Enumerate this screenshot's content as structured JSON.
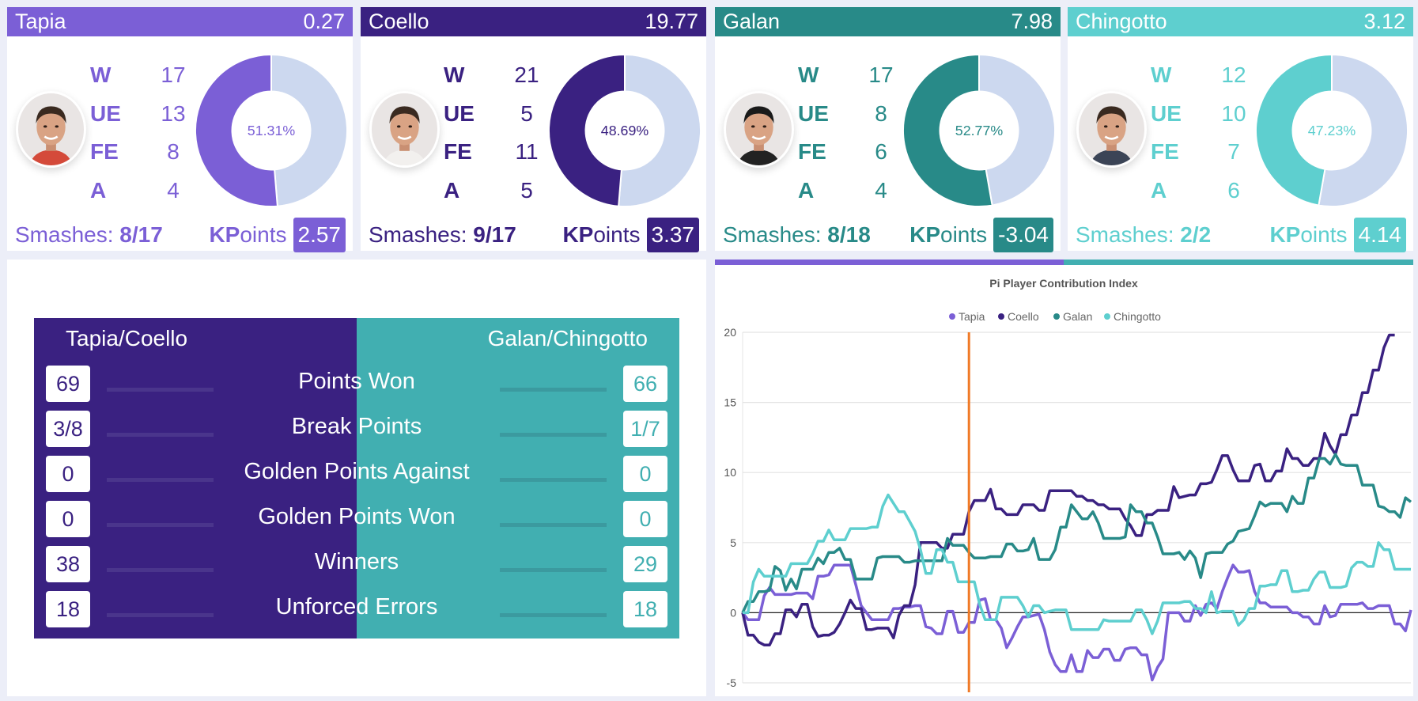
{
  "players": [
    {
      "name": "Tapia",
      "score": "0.27",
      "color": "#7b5fd6",
      "W": "17",
      "UE": "13",
      "FE": "8",
      "A": "4",
      "pct": 51.31,
      "pct_label": "51.31%",
      "smashes_label": "Smashes:",
      "smashes": "8/17",
      "kp_k": "KP",
      "kp_rest": "oints",
      "kpoints": "2.57",
      "avatar": "player-photo"
    },
    {
      "name": "Coello",
      "score": "19.77",
      "color": "#3a2181",
      "W": "21",
      "UE": "5",
      "FE": "11",
      "A": "5",
      "pct": 48.69,
      "pct_label": "48.69%",
      "smashes_label": "Smashes:",
      "smashes": "9/17",
      "kp_k": "KP",
      "kp_rest": "oints",
      "kpoints": "3.37",
      "avatar": "player-photo"
    },
    {
      "name": "Galan",
      "score": "7.98",
      "color": "#288a88",
      "W": "17",
      "UE": "8",
      "FE": "6",
      "A": "4",
      "pct": 52.77,
      "pct_label": "52.77%",
      "smashes_label": "Smashes:",
      "smashes": "8/18",
      "kp_k": "KP",
      "kp_rest": "oints",
      "kpoints": "-3.04",
      "avatar": "player-photo"
    },
    {
      "name": "Chingotto",
      "score": "3.12",
      "color": "#5ecfcf",
      "W": "12",
      "UE": "10",
      "FE": "7",
      "A": "6",
      "pct": 47.23,
      "pct_label": "47.23%",
      "smashes_label": "Smashes:",
      "smashes": "2/2",
      "kp_k": "KP",
      "kp_rest": "oints",
      "kpoints": "4.14",
      "avatar": "player-photo"
    }
  ],
  "stat_labels": {
    "W": "W",
    "UE": "UE",
    "FE": "FE",
    "A": "A"
  },
  "donut_remainder_color": "#ccd8ef",
  "comparison": {
    "left_team": "Tapia/Coello",
    "right_team": "Galan/Chingotto",
    "left_color": "#3a2181",
    "right_color": "#41afb1",
    "rows": [
      {
        "label": "Points Won",
        "left": "69",
        "right": "66"
      },
      {
        "label": "Break Points",
        "left": "3/8",
        "right": "1/7"
      },
      {
        "label": "Golden Points Against",
        "left": "0",
        "right": "0"
      },
      {
        "label": "Golden Points Won",
        "left": "0",
        "right": "0"
      },
      {
        "label": "Winners",
        "left": "38",
        "right": "29"
      },
      {
        "label": "Unforced Errors",
        "left": "18",
        "right": "18"
      }
    ]
  },
  "chart_data": {
    "type": "line",
    "title": "Pi Player Contribution Index",
    "xlabel": "",
    "ylabel": "",
    "ylim": [
      -5,
      20
    ],
    "yticks": [
      "20",
      "15",
      "10",
      "5",
      "0",
      "-5"
    ],
    "grid": true,
    "legend": "top-center",
    "marker_index": 42,
    "marker_color": "#f07a26",
    "series": [
      {
        "name": "Tapia",
        "color": "#7b5fd6",
        "values": [
          0,
          -0.5,
          -0.5,
          -0.5,
          1.2,
          1.8,
          1.3,
          1.3,
          1.3,
          1.3,
          1.4,
          1.4,
          1.4,
          1,
          2.6,
          2.6,
          2.7,
          3.4,
          3.4,
          3.4,
          3.4,
          2,
          0.5,
          0,
          -0.5,
          -0.5,
          -0.5,
          -0.5,
          0.3,
          0.3,
          0.4,
          0.4,
          0.5,
          0.5,
          -1,
          -1.1,
          -1.5,
          -1.5,
          0.1,
          0.1,
          -1.4,
          -1.4,
          -0.7,
          -0.7,
          0.9,
          1,
          -0.5,
          -0.5,
          -1.1,
          -2.5,
          -1.8,
          -1,
          -0.3,
          -0.3,
          -0.2,
          -0.1,
          -1.2,
          -2.8,
          -3.7,
          -4.2,
          -4.2,
          -3,
          -4.2,
          -4.2,
          -2.7,
          -3.2,
          -3.2,
          -2.6,
          -2.6,
          -3.4,
          -3.4,
          -2.6,
          -2.5,
          -2.5,
          -3,
          -3,
          -4.8,
          -3.9,
          -3.3,
          0,
          0,
          0,
          -0.6,
          -0.6,
          0.5,
          -0.2,
          0.6,
          0.7,
          0.3,
          1.5,
          2.5,
          3.4,
          2.9,
          2.9,
          3,
          1.5,
          0.7,
          0.7,
          0.4,
          0.4,
          0.4,
          0.4,
          0,
          0,
          -0.3,
          -0.3,
          -0.8,
          -0.8,
          0.5,
          -0.3,
          -0.2,
          0.6,
          0.6,
          0.6,
          0.6,
          0.7,
          0.3,
          0.3,
          0.5,
          0.5,
          0.5,
          -0.8,
          -0.8,
          -1.3,
          0.2
        ]
      },
      {
        "name": "Coello",
        "color": "#3a2181",
        "values": [
          0,
          -1.6,
          -1.6,
          -2.1,
          -2.3,
          -2.3,
          -1.5,
          -1.5,
          0.2,
          0.2,
          -0.3,
          0.6,
          0.6,
          -1,
          -1.7,
          -1.6,
          -1.6,
          -1.4,
          -0.8,
          0,
          0.9,
          0.3,
          0.3,
          -1.2,
          -1.2,
          -1.1,
          -1.1,
          -1.1,
          -1.8,
          -0.2,
          0.5,
          0.5,
          2,
          5,
          5,
          5,
          5,
          4.6,
          4.6,
          5.6,
          5.6,
          5.6,
          7.2,
          8,
          8,
          8,
          8.8,
          7.4,
          7.4,
          7,
          7,
          7,
          7.7,
          7.7,
          7.7,
          7.3,
          7.3,
          8.7,
          8.7,
          8.7,
          8.7,
          8.7,
          8.3,
          8.3,
          8,
          8,
          7.7,
          7.7,
          7.4,
          7.4,
          7.4,
          6.7,
          6.2,
          5.5,
          5.5,
          7,
          7,
          7.3,
          7.3,
          7.3,
          9,
          8.2,
          8.3,
          8.4,
          8.4,
          9.2,
          9.2,
          9.3,
          10.2,
          11.2,
          11.2,
          10.2,
          9.4,
          9.4,
          9.4,
          10.5,
          10.6,
          9.4,
          9.4,
          10.1,
          10.1,
          11.7,
          11,
          11,
          10.5,
          10.5,
          11,
          11,
          12.8,
          11.9,
          11.3,
          12.7,
          12.7,
          14.1,
          14.1,
          15.7,
          15.7,
          17.3,
          17.3,
          18.9,
          19.8,
          19.8
        ]
      },
      {
        "name": "Galan",
        "color": "#288a88",
        "values": [
          0,
          0.8,
          0.8,
          1.5,
          1.5,
          1.6,
          3.3,
          3,
          1.6,
          2.4,
          1.7,
          3.1,
          3.1,
          3.1,
          3.9,
          3.5,
          4.3,
          4.3,
          4.6,
          3.8,
          3.8,
          2.4,
          2.4,
          2.4,
          2.4,
          3.9,
          4,
          4,
          4,
          4,
          3.6,
          3.6,
          3.7,
          3.7,
          3.7,
          3.7,
          3.7,
          3.7,
          5.3,
          4.8,
          4.8,
          4.8,
          4.3,
          3.9,
          3.9,
          3.9,
          4,
          4,
          4,
          4.9,
          4.9,
          4.4,
          4.4,
          4.5,
          5.3,
          3.8,
          3.8,
          3.8,
          4.5,
          6.1,
          6.1,
          7.7,
          7.2,
          6.7,
          6.7,
          7.2,
          6.4,
          5.3,
          5.3,
          5.3,
          5.3,
          5.4,
          7.7,
          7.2,
          7.2,
          6.4,
          6.4,
          5.4,
          4.2,
          4.2,
          4.2,
          4.3,
          3.8,
          4.4,
          3.9,
          2.5,
          4.2,
          4.3,
          4.3,
          4.3,
          4.9,
          5.1,
          5.8,
          5.9,
          6,
          6.9,
          7.9,
          7.6,
          7.8,
          7.8,
          7.8,
          7.2,
          8.3,
          7.8,
          7.8,
          9.6,
          9.6,
          11,
          11,
          10.6,
          11.3,
          10.6,
          10.5,
          10.5,
          10.5,
          9.1,
          9.1,
          9.1,
          7.6,
          7.5,
          7.2,
          7.2,
          6.8,
          8.2,
          7.9
        ]
      },
      {
        "name": "Chingotto",
        "color": "#5ecfcf",
        "values": [
          0,
          0,
          2.2,
          3.1,
          2.6,
          2.6,
          2.6,
          2.6,
          2.6,
          3.5,
          3.5,
          3.5,
          3.5,
          4.2,
          5.1,
          5.1,
          5.9,
          5.2,
          5.2,
          5.2,
          6,
          6,
          6,
          6,
          6.1,
          6.1,
          7.6,
          8.4,
          7.8,
          7.2,
          7.2,
          6.5,
          5.8,
          4.5,
          2.8,
          2.8,
          4.5,
          4.5,
          3.6,
          3.6,
          2.2,
          2.2,
          2.2,
          2.2,
          0.6,
          -0.5,
          -0.5,
          -0.5,
          1.1,
          1.1,
          1.1,
          1.1,
          0.5,
          -0.3,
          0.5,
          0.5,
          0,
          0.1,
          0.2,
          0.2,
          0.2,
          -1.2,
          -1.2,
          -1.2,
          -1.2,
          -1.2,
          -1.2,
          -0.5,
          -0.6,
          -0.6,
          -0.6,
          -0.6,
          -0.6,
          0.2,
          0.2,
          -0.5,
          -1.5,
          -0.6,
          0.7,
          0.7,
          0.7,
          0.7,
          0.8,
          0.8,
          0.3,
          0.3,
          0,
          1.5,
          0,
          0.1,
          0.1,
          0.1,
          -0.9,
          -0.5,
          0.3,
          0.3,
          1.9,
          1.9,
          2,
          2,
          3,
          3,
          1.5,
          1.5,
          1.6,
          1.6,
          2.4,
          2.9,
          2.9,
          1.8,
          1.8,
          1.8,
          1.9,
          3.2,
          3.6,
          3.6,
          3.3,
          3.3,
          5,
          4.5,
          4.5,
          3.1,
          3.1,
          3.1,
          3.1
        ]
      }
    ]
  }
}
